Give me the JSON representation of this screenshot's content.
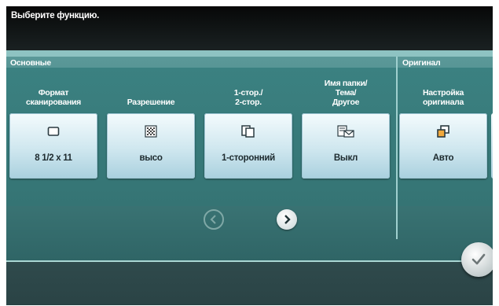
{
  "header": {
    "title": "Выберите функцию."
  },
  "groups": {
    "basic_label": "Основные",
    "original_label": "Оригинал"
  },
  "columns": [
    {
      "label_lines": [
        "Формат",
        "сканирования"
      ],
      "value": "8 1/2 x 11",
      "icon": "paper-size-icon"
    },
    {
      "label_lines": [
        "Разрешение"
      ],
      "value": "высо",
      "icon": "resolution-icon"
    },
    {
      "label_lines": [
        "1-стор./",
        "2-стор."
      ],
      "value": "1-сторонний",
      "icon": "duplex-icon"
    },
    {
      "label_lines": [
        "Имя папки/",
        "Тема/",
        "Другое"
      ],
      "value": "Выкл",
      "icon": "folder-name-icon"
    },
    {
      "label_lines": [
        "Настройка",
        "оригинала"
      ],
      "value": "Авто",
      "icon": "original-setting-icon"
    }
  ],
  "navigation": {
    "prev_icon": "chevron-left-icon",
    "next_icon": "chevron-right-icon"
  },
  "ok": {
    "icon": "checkmark-icon"
  },
  "colors": {
    "header": "#0b0e0f",
    "panel": "#4c8e8e",
    "tile": "#cfe7ef",
    "footer": "#2f4a4c"
  }
}
